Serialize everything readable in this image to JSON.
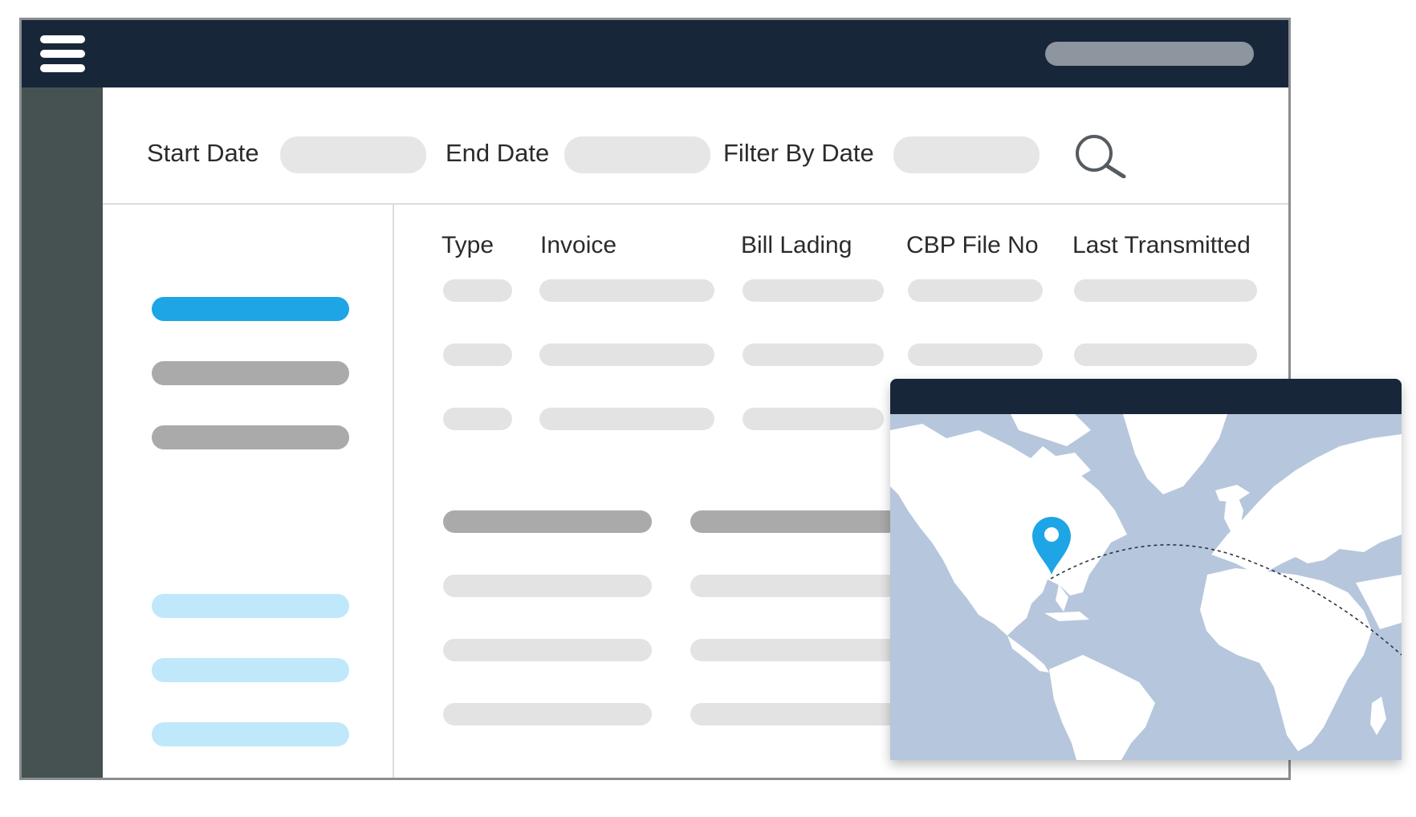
{
  "filters": {
    "start_date_label": "Start Date",
    "end_date_label": "End Date",
    "filter_by_date_label": "Filter By Date",
    "start_date_value": "",
    "end_date_value": "",
    "filter_by_date_value": ""
  },
  "table": {
    "columns": [
      "Type",
      "Invoice",
      "Bill Lading",
      "CBP File No",
      "Last Transmitted"
    ]
  },
  "icons": {
    "menu": "hamburger-menu-icon",
    "search": "magnifier-search-icon",
    "map_pin": "location-pin-icon"
  },
  "colors": {
    "header_bg": "#18263a",
    "rail_bg": "#465252",
    "accent_blue": "#1ea5e6",
    "light_blue": "#bfe8fb",
    "placeholder_gray": "#e3e3e3",
    "dark_gray": "#aaaaaa",
    "ocean": "#b6c6dc",
    "land": "#ffffff"
  }
}
